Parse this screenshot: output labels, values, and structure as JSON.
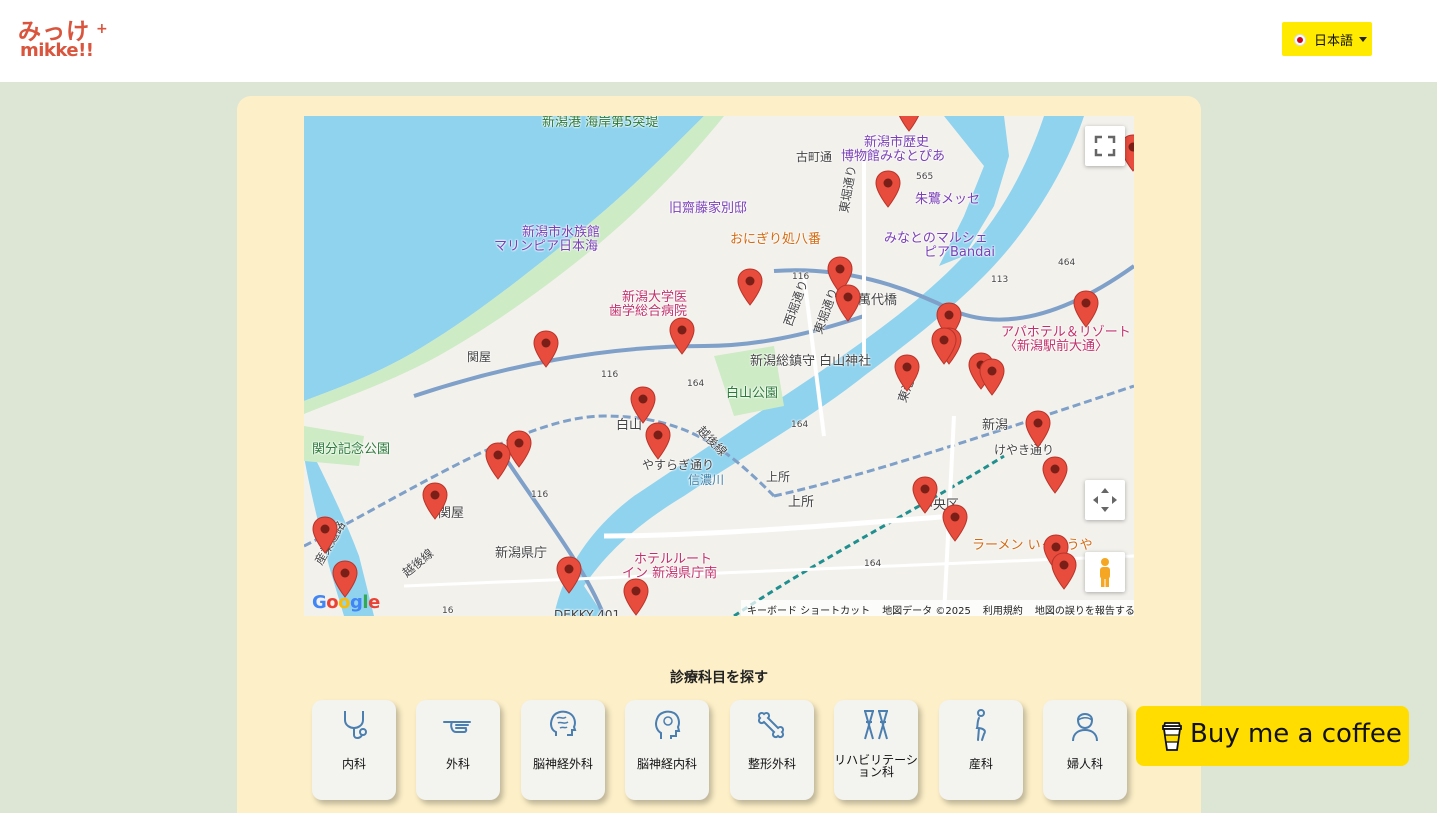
{
  "header": {
    "logo_jp": "みっけ",
    "logo_plus": "+",
    "logo_en": "mikke!!",
    "language_label": "日本語"
  },
  "map": {
    "labels": {
      "port": "新潟港 海岸第5突堤",
      "furumachi": "古町通",
      "history_museum_1": "新潟市歴史",
      "history_museum_2": "博物館みなとぴあ",
      "route565": "565",
      "toki_messe": "朱鷺メッセ",
      "saito": "旧齋藤家別邸",
      "aquarium_1": "新潟市水族館",
      "aquarium_2": "マリンピア日本海",
      "onigiri": "おにぎり処八番",
      "marche_1": "みなとのマルシェ",
      "marche_2": "ピアBandai",
      "route464": "464",
      "route113": "113",
      "route116a": "116",
      "hospital_1": "新潟大学医",
      "hospital_2": "歯学総合病院",
      "bandai_bridge": "萬代橋",
      "apa_1": "アパホテル＆リゾート",
      "apa_2": "〈新潟駅前大通〉",
      "sekiya": "関屋",
      "hakusan_shrine": "新潟総鎮守 白山神社",
      "route116b": "116",
      "route164a": "164",
      "hakusan_park": "白山公園",
      "kanpu_park": "関分記念公園",
      "hakusan": "白山",
      "niigata_st": "新潟",
      "route164b": "164",
      "keyaki": "けやき通り",
      "yasuragi": "やすらぎ通り",
      "shinano": "信濃川",
      "kamitokoro_1": "上所",
      "kamitokoro_2": "上所",
      "chuo_ku": "中央区",
      "route116c": "116",
      "sekiya_st": "関屋",
      "ramen": "ラーメン いっこうや",
      "kencho": "新潟県庁",
      "hotel_1": "ホテルルート",
      "hotel_2": "イン 新潟県庁南",
      "route164c": "164",
      "route16": "16",
      "sangyo": "産業道路",
      "etsugo_a": "越後線",
      "etsugo_b": "越後線",
      "toko": "東港線",
      "nishibori": "西堀通り",
      "higashibori": "東堀通り",
      "higashiko2": "東堀通り",
      "deikey": "DEKKY 401"
    },
    "footer": {
      "shortcuts": "キーボード ショートカット",
      "map_data": "地図データ ©2025",
      "terms": "利用規約",
      "report": "地図の誤りを報告する"
    },
    "google_logo": "Google",
    "colors": {
      "water": "#8fd3ef",
      "land": "#f3f1ec",
      "park": "#cdebc5",
      "pin": "#e84c3d",
      "road": "#ffffff",
      "major_road": "#7fa0c8"
    }
  },
  "departments": {
    "title": "診療科目を探す",
    "items": [
      {
        "label": "内科",
        "icon": "stethoscope-icon"
      },
      {
        "label": "外科",
        "icon": "pointing-hand-icon"
      },
      {
        "label": "脳神経外科",
        "icon": "brain-icon"
      },
      {
        "label": "脳神経内科",
        "icon": "head-icon"
      },
      {
        "label": "整形外科",
        "icon": "bone-icon"
      },
      {
        "label": "リハビリテーション科",
        "icon": "crutches-icon"
      },
      {
        "label": "産科",
        "icon": "pregnant-icon"
      },
      {
        "label": "婦人科",
        "icon": "woman-icon"
      }
    ]
  },
  "coffee": {
    "label": "Buy me a coffee",
    "color": "#ffdd00"
  }
}
